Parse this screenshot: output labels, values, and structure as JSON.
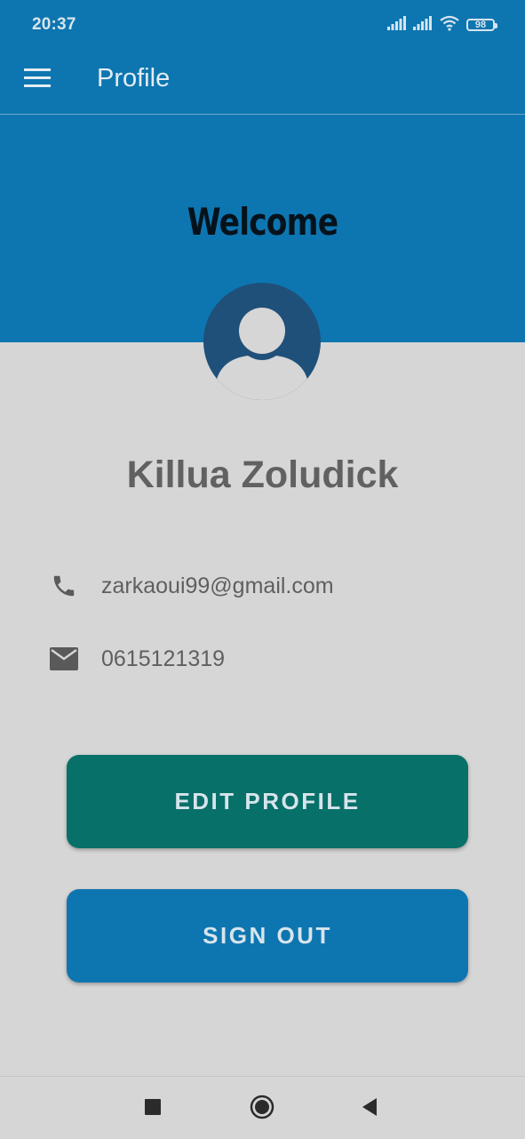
{
  "status_bar": {
    "time": "20:37",
    "battery": "98",
    "icons": [
      "signal-icon",
      "signal-icon",
      "wifi-icon",
      "battery-icon"
    ]
  },
  "app_bar": {
    "title": "Profile",
    "menu_icon": "hamburger-menu-icon"
  },
  "hero": {
    "welcome": "Welcome",
    "avatar_icon": "person-avatar-icon"
  },
  "profile": {
    "name": "Killua Zoludick",
    "email_row": {
      "icon": "phone-icon",
      "text": "zarkaoui99@gmail.com"
    },
    "phone_row": {
      "icon": "mail-icon",
      "text": "0615121319"
    }
  },
  "actions": {
    "edit_label": "EDIT PROFILE",
    "signout_label": "SIGN OUT"
  },
  "nav_bar": {
    "icons": [
      "recent-apps-icon",
      "home-icon",
      "back-icon"
    ]
  },
  "colors": {
    "primary": "#0d76b0",
    "edit_button": "#077068",
    "background": "#d6d6d6",
    "avatar": "#1f5079"
  }
}
